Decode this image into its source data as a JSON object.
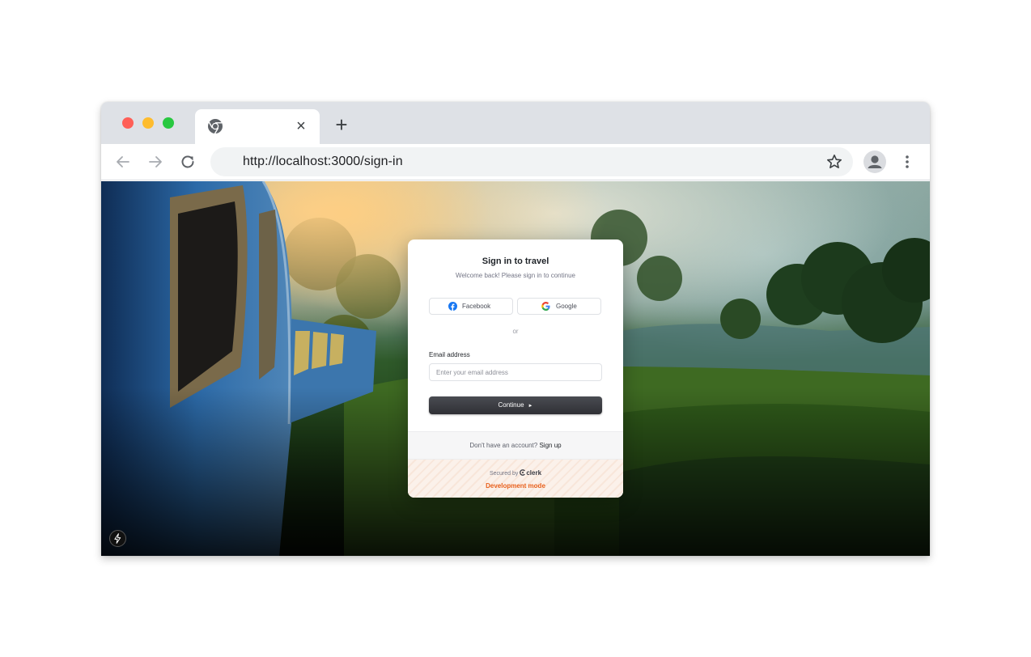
{
  "browser": {
    "url": "http://localhost:3000/sign-in",
    "tab": {
      "favicon": "chrome-icon",
      "close": "×"
    },
    "new_tab": "+"
  },
  "icons": {
    "back": "arrow-left-icon",
    "forward": "arrow-right-icon",
    "reload": "reload-icon",
    "bookmark": "star-icon",
    "profile": "person-icon",
    "menu": "kebab-menu-icon",
    "dev_indicator": "lightning-icon"
  },
  "sign_in": {
    "title": "Sign in to travel",
    "subtitle": "Welcome back! Please sign in to continue",
    "facebook_label": "Facebook",
    "google_label": "Google",
    "divider": "or",
    "email_label": "Email address",
    "email_placeholder": "Enter your email address",
    "email_value": "",
    "continue_label": "Continue",
    "continue_arrow": "►",
    "no_account": "Don't have an account?",
    "sign_up": "Sign up",
    "secured_by": "Secured by",
    "clerk": "clerk",
    "dev_mode": "Development mode"
  },
  "colors": {
    "continue_bg": "#2f3035",
    "dev_mode": "#e8601c",
    "facebook": "#1877f2"
  }
}
